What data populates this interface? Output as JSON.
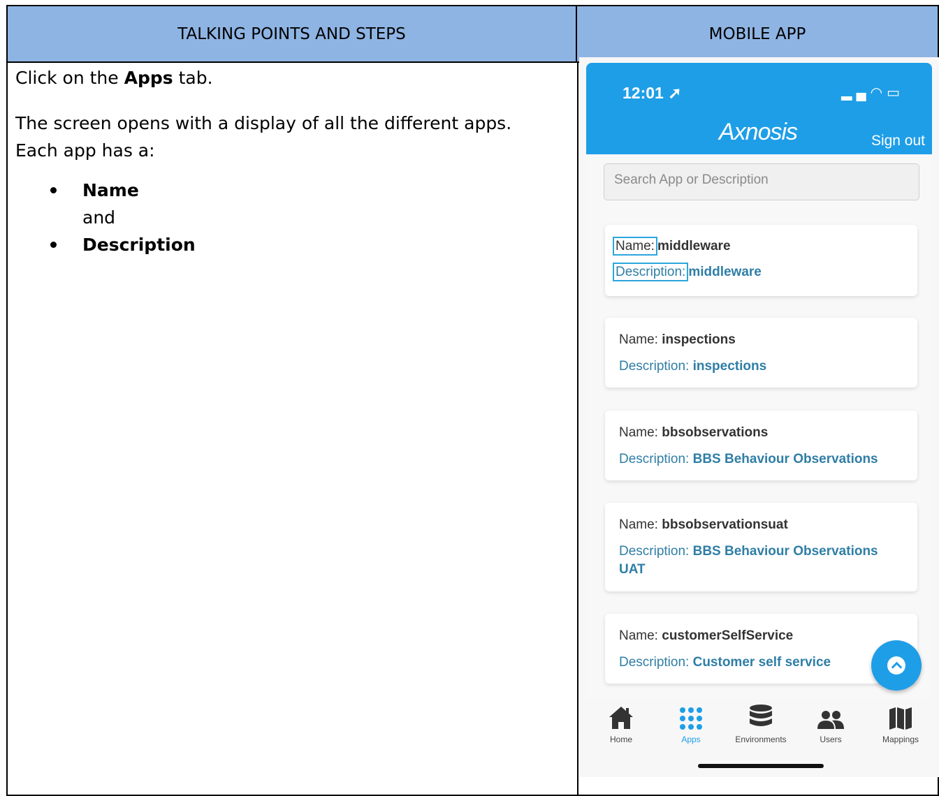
{
  "table": {
    "left_header": "TALKING POINTS AND STEPS",
    "right_header": "MOBILE APP"
  },
  "steps": {
    "line1_pre": "Click on the ",
    "line1_bold": "Apps",
    "line1_post": " tab.",
    "line2": "The screen opens with a display of all the different apps.",
    "line3": "Each app has a:",
    "bullet1": "Name",
    "connector": "and",
    "bullet2": "Description"
  },
  "phone": {
    "time": "12:01",
    "logo": "Axnosis",
    "signout": "Sign out",
    "search_placeholder": "Search App or Description",
    "name_label": "Name:",
    "desc_label": "Description:",
    "apps": [
      {
        "name": "middleware",
        "description": "middleware"
      },
      {
        "name": "inspections",
        "description": "inspections"
      },
      {
        "name": "bbsobservations",
        "description": "BBS Behaviour Observations"
      },
      {
        "name": "bbsobservationsuat",
        "description": "BBS Behaviour Observations",
        "description_2": "UAT"
      },
      {
        "name": "customerSelfService",
        "description": "Customer self service"
      }
    ],
    "tabs": [
      {
        "label": "Home",
        "icon": "home-icon"
      },
      {
        "label": "Apps",
        "icon": "apps-grid-icon",
        "active": true
      },
      {
        "label": "Environments",
        "icon": "database-icon"
      },
      {
        "label": "Users",
        "icon": "users-icon"
      },
      {
        "label": "Mappings",
        "icon": "map-icon"
      }
    ],
    "accent": "#1e9ee7"
  }
}
